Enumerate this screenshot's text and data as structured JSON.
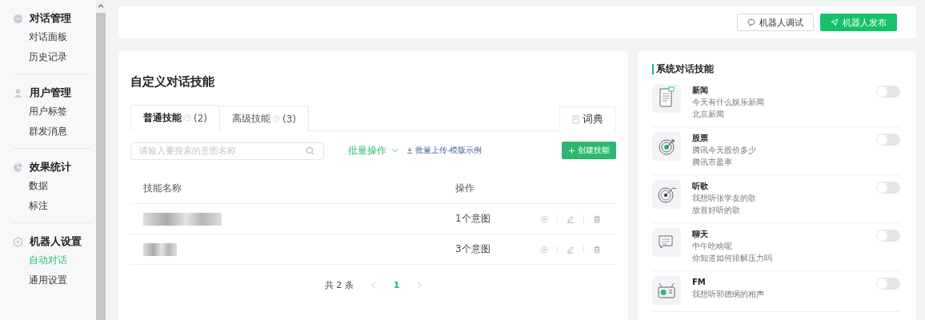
{
  "sidebar": {
    "groups": [
      {
        "kind": "dialog",
        "title": "对话管理",
        "items": [
          {
            "label": "对话面板",
            "selected": false
          },
          {
            "label": "历史记录",
            "selected": false
          }
        ]
      },
      {
        "kind": "user",
        "title": "用户管理",
        "items": [
          {
            "label": "用户标签",
            "selected": false
          },
          {
            "label": "群发消息",
            "selected": false
          }
        ]
      },
      {
        "kind": "chart",
        "title": "效果统计",
        "items": [
          {
            "label": "数据",
            "selected": false
          },
          {
            "label": "标注",
            "selected": false
          }
        ]
      },
      {
        "kind": "gear",
        "title": "机器人设置",
        "items": [
          {
            "label": "自动对话",
            "selected": true
          },
          {
            "label": "通用设置",
            "selected": false
          }
        ]
      }
    ]
  },
  "header": {
    "buttons": [
      {
        "kind": "debug",
        "label": "机器人调试"
      },
      {
        "kind": "publish",
        "label": "机器人发布"
      }
    ]
  },
  "custom_skills": {
    "title": "自定义对话技能",
    "tabs": [
      {
        "label": "普通技能",
        "count": "(2)",
        "selected": true
      },
      {
        "label": "高级技能",
        "count": "(3)",
        "selected": false
      }
    ],
    "dictionary_button": "词典",
    "search": {
      "placeholder": "请输入要搜索的意图名称"
    },
    "batch_menu": "批量操作",
    "upload_link": "批量上传-模版示例",
    "create_button": "创建技能",
    "table": {
      "columns": [
        "技能名称",
        "操作"
      ],
      "rows": [
        {
          "intents": "1个意图"
        },
        {
          "intents": "3个意图"
        }
      ]
    },
    "pagination": {
      "total": "共 2 条",
      "pages": [
        {
          "label": "1",
          "selected": true
        }
      ]
    }
  },
  "system_skills": {
    "title": "系统对话技能",
    "items": [
      {
        "kind": "news",
        "name": "新闻",
        "examples": [
          "今天有什么娱乐新闻",
          "北京新闻"
        ],
        "on": false
      },
      {
        "kind": "stock",
        "name": "股票",
        "examples": [
          "腾讯今天股价多少",
          "腾讯市盈率"
        ],
        "on": false
      },
      {
        "kind": "music",
        "name": "听歌",
        "examples": [
          "我想听张学友的歌",
          "放首好听的歌"
        ],
        "on": false
      },
      {
        "kind": "chat",
        "name": "聊天",
        "examples": [
          "中午吃啥呢",
          "你知道如何排解压力吗"
        ],
        "on": false
      },
      {
        "kind": "radio",
        "name": "FM",
        "examples": [
          "我想听郭德纲的相声"
        ],
        "on": false
      }
    ]
  }
}
